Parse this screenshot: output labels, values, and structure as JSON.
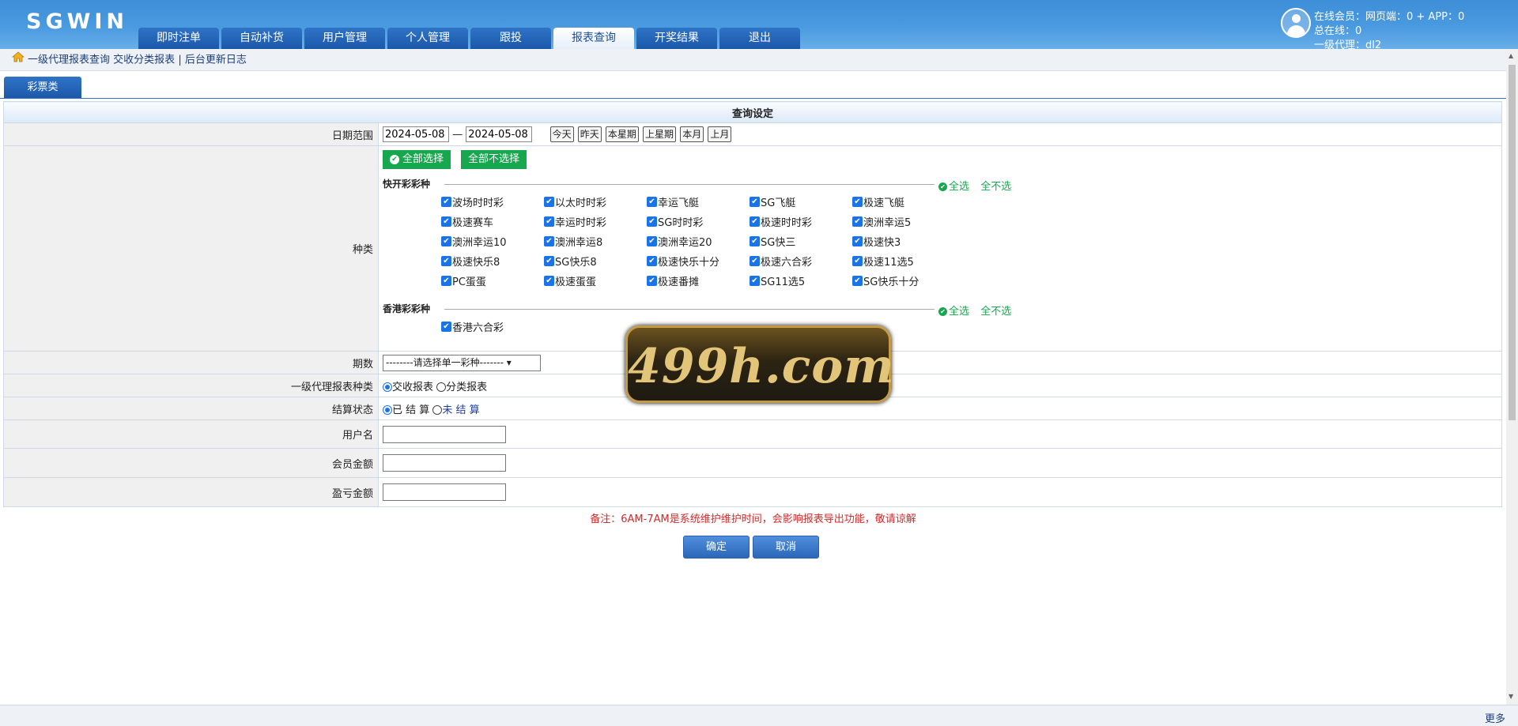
{
  "header": {
    "logo": "SGWIN",
    "nav": [
      "即时注单",
      "自动补货",
      "用户管理",
      "个人管理",
      "跟投",
      "报表查询",
      "开奖结果",
      "退出"
    ],
    "active_nav": "报表查询",
    "online_members": "在线会员：网页端：0 + APP：0",
    "total_online": "总在线：0",
    "agent": "一级代理：dl2"
  },
  "breadcrumb": {
    "current": "一级代理报表查询",
    "link1": "交收分类报表",
    "separator": "|",
    "link2": "后台更新日志"
  },
  "subtab": "彩票类",
  "form": {
    "title": "查询设定",
    "date_label": "日期范围",
    "date_from": "2024-05-08",
    "date_sep": "—",
    "date_to": "2024-05-08",
    "quick_buttons": [
      "今天",
      "昨天",
      "本星期",
      "上星期",
      "本月",
      "上月"
    ],
    "type_label": "种类",
    "select_all": "全部选择",
    "select_none": "全部不选择",
    "group_select_all": "全选",
    "group_select_none": "全不选",
    "groups": [
      {
        "title": "快开彩彩种",
        "games": [
          "波场时时彩",
          "以太时时彩",
          "幸运飞艇",
          "SG飞艇",
          "极速飞艇",
          "极速赛车",
          "幸运时时彩",
          "SG时时彩",
          "极速时时彩",
          "澳洲幸运5",
          "澳洲幸运10",
          "澳洲幸运8",
          "澳洲幸运20",
          "SG快三",
          "极速快3",
          "极速快乐8",
          "SG快乐8",
          "极速快乐十分",
          "极速六合彩",
          "极速11选5",
          "PC蛋蛋",
          "极速蛋蛋",
          "极速番摊",
          "SG11选5",
          "SG快乐十分"
        ]
      },
      {
        "title": "香港彩彩种",
        "games": [
          "香港六合彩"
        ]
      }
    ],
    "period_label": "期数",
    "period_select": "--------请选择单一彩种-------",
    "report_type_label": "一级代理报表种类",
    "report_types": [
      "交收报表",
      "分类报表"
    ],
    "settle_label": "结算状态",
    "settle_options": [
      "已 结 算",
      "未 结 算"
    ],
    "username_label": "用户名",
    "member_amount_label": "会员金额",
    "profit_label": "盈亏金额"
  },
  "note": "备注：6AM-7AM是系统维护维护时间，会影响报表导出功能，敬请谅解",
  "buttons": {
    "confirm": "确定",
    "cancel": "取消"
  },
  "watermark": "499h.com",
  "footer": {
    "more": "更多"
  },
  "colors": {
    "header_blue": "#4a9ae0",
    "tab_blue": "#1b57a8",
    "green": "#17a74f",
    "note_red": "#d32b2b"
  }
}
